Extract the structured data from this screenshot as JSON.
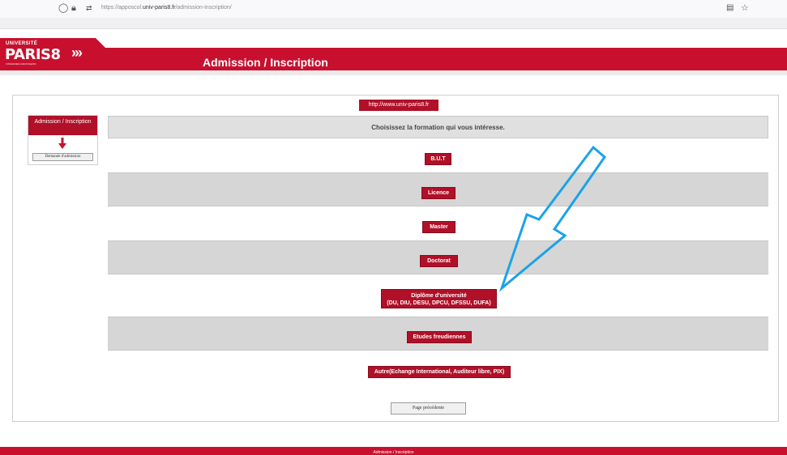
{
  "browser": {
    "url_prefix": "https://apposcol.",
    "url_domain": "univ-paris8.fr",
    "url_path": "/admission-inscription/"
  },
  "header": {
    "logo_univ": "UNIVERSITÉ",
    "logo_name": "PARIS8",
    "logo_tagline": "VINCENNES-SAINT-DENIS",
    "chevrons": "›››",
    "title": "Admission / Inscription"
  },
  "sidebar": {
    "heading": "Admission / Inscription",
    "button_label": "Demande d'admission"
  },
  "main": {
    "site_link": "http://www.univ-paris8.fr",
    "prompt": "Choisissez la formation qui vous intéresse.",
    "options": [
      {
        "label": "B.U.T"
      },
      {
        "label": "Licence"
      },
      {
        "label": "Master"
      },
      {
        "label": "Doctorat"
      },
      {
        "label": "Diplôme d'université",
        "sub": "(DU, DIU, DESU, DPCU, DFSSU, DUFA)"
      },
      {
        "label": "Etudes freudiennes"
      },
      {
        "label": "Autre(Echange International, Auditeur libre, PIX)"
      }
    ],
    "prev_button": "Page précédente"
  },
  "footer": {
    "text": "Admission / Inscription"
  },
  "colors": {
    "brand_red": "#c8102e",
    "button_red": "#b01028",
    "annotation_arrow": "#1aa3e8"
  }
}
